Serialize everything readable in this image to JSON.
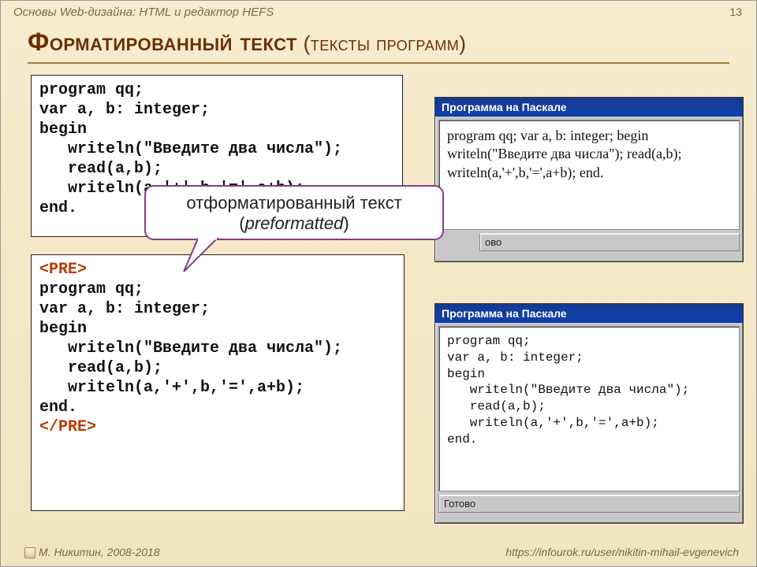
{
  "header": {
    "breadcrumb": "Основы Web-дизайна: HTML и редактор HEFS",
    "page_number": "13"
  },
  "title": {
    "main": "Форматированный текст",
    "sub": " (тексты программ)"
  },
  "code1": "program qq;\nvar a, b: integer;\nbegin\n   writeln(\"Введите два числа\");\n   read(a,b);\n   writeln(a,'+',b,'=',a+b);\nend.",
  "code2": {
    "open": "<PRE>",
    "body": "program qq;\nvar a, b: integer;\nbegin\n   writeln(\"Введите два числа\");\n   read(a,b);\n   writeln(a,'+',b,'=',a+b);\nend.",
    "close": "</PRE>"
  },
  "callout": {
    "line1": "отформатированный текст",
    "line2_open": "(",
    "line2_word": "preformatted",
    "line2_close": ")"
  },
  "win1": {
    "title": "Программа на Паскале",
    "body": "program qq; var a, b: integer; begin writeln(\"Введите два числа\"); read(a,b); writeln(a,'+',b,'=',a+b); end.",
    "status": "ово"
  },
  "win2": {
    "title": "Программа на Паскале",
    "body": "program qq;\nvar a, b: integer;\nbegin\n   writeln(\"Введите два числа\");\n   read(a,b);\n   writeln(a,'+',b,'=',a+b);\nend.",
    "status": "Готово"
  },
  "footer": {
    "author": "М. Никитин, 2008-2018",
    "url": "https://infourok.ru/user/nikitin-mihail-evgenevich"
  }
}
